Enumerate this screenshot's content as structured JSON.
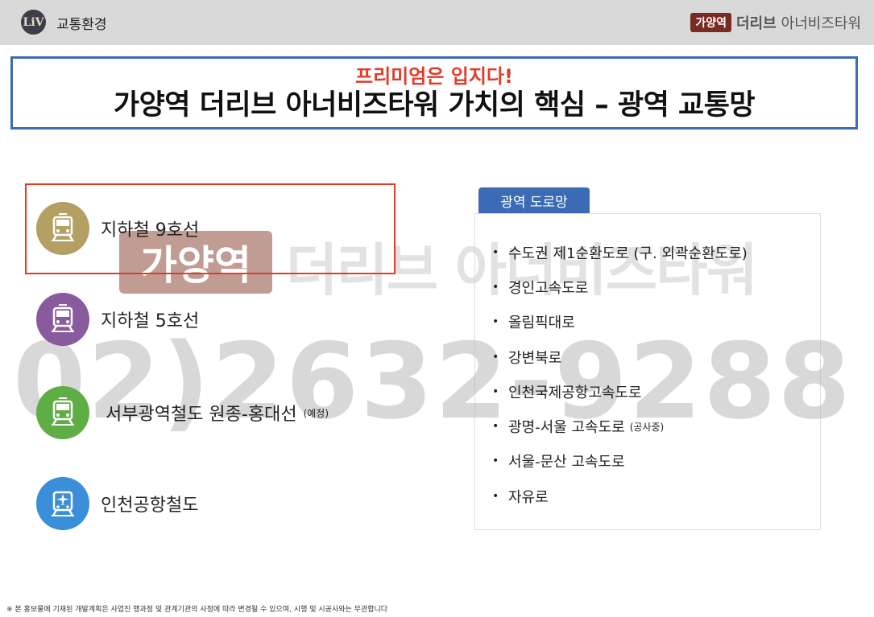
{
  "header": {
    "logo_text": "LiV",
    "section_title": "교통환경",
    "brand_tag": "가양역",
    "brand_name": "더리브",
    "brand_sub": "아너비즈타워"
  },
  "headline": {
    "subtitle": "프리미엄은 입지다!",
    "title": "가양역 더리브 아너비즈타워 가치의 핵심 – 광역 교통망"
  },
  "watermark": {
    "tag": "가양역",
    "name": "더리브 아너비즈타워",
    "phone": "02)2632-9288"
  },
  "rail_lines": [
    {
      "label": "지하철 9호선",
      "note": "",
      "color": "#b5a063",
      "icon": "train-icon"
    },
    {
      "label": "지하철 5호선",
      "note": "",
      "color": "#8a5a9e",
      "icon": "train-icon"
    },
    {
      "label": "서부광역철도 원종-홍대선",
      "note": "(예정)",
      "color": "#5fae45",
      "icon": "train-icon"
    },
    {
      "label": "인천공항철도",
      "note": "",
      "color": "#3b8ed8",
      "icon": "airport-train-icon"
    }
  ],
  "roads": {
    "tab_label": "광역 도로망",
    "items": [
      {
        "label": "수도권 제1순환도로 (구. 외곽순환도로)",
        "note": ""
      },
      {
        "label": "경인고속도로",
        "note": ""
      },
      {
        "label": "올림픽대로",
        "note": ""
      },
      {
        "label": "강변북로",
        "note": ""
      },
      {
        "label": "인천국제공항고속도로",
        "note": ""
      },
      {
        "label": "광명-서울 고속도로",
        "note": "(공사중)"
      },
      {
        "label": "서울-문산 고속도로",
        "note": ""
      },
      {
        "label": "자유로",
        "note": ""
      }
    ]
  },
  "footnote": "※ 본 홍보물에 기재된 개발계획은 사업진 행과정 및 관계기관의 사정에 따라 변경될 수 있으며, 시행 및 시공사와는 무관합니다",
  "colors": {
    "accent_blue": "#3c6bb5",
    "accent_red": "#e23b2a",
    "brand_brown": "#7a2a22"
  }
}
